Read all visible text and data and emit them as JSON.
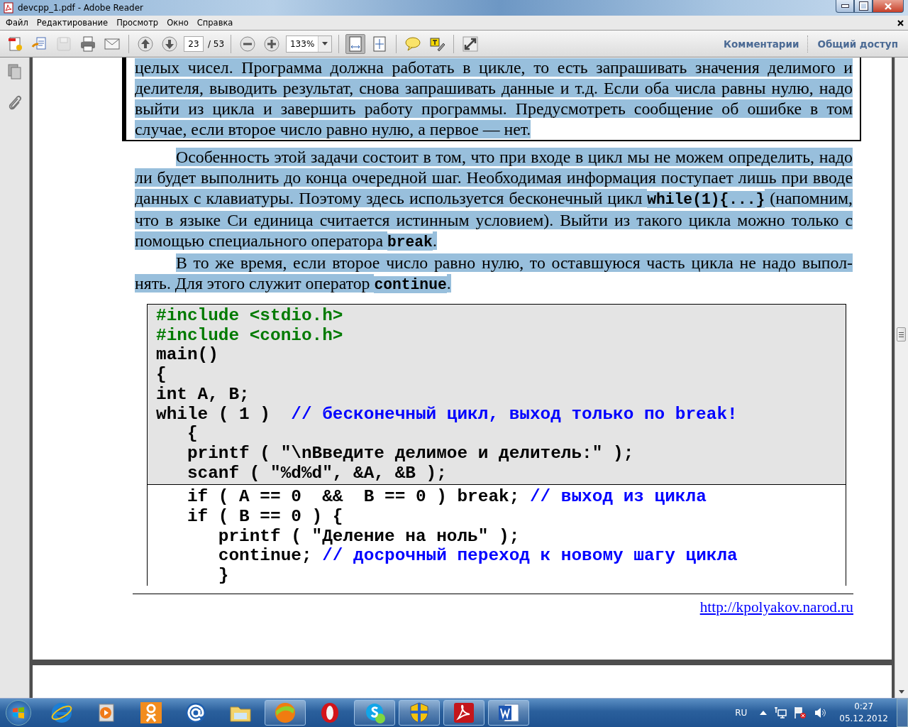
{
  "window": {
    "title": "devcpp_1.pdf - Adobe Reader"
  },
  "menu": [
    "Файл",
    "Редактирование",
    "Просмотр",
    "Окно",
    "Справка"
  ],
  "toolbar": {
    "buttons": [
      {
        "disabled": false,
        "selected": false
      },
      {
        "disabled": false,
        "selected": false
      },
      {
        "disabled": true,
        "selected": false
      },
      {
        "disabled": false,
        "selected": false
      },
      {
        "disabled": false,
        "selected": false
      },
      {
        "disabled": false,
        "selected": false
      },
      {
        "disabled": false,
        "selected": false
      },
      {
        "disabled": false,
        "selected": false
      },
      {
        "disabled": false,
        "selected": false
      },
      {
        "disabled": false,
        "selected": true
      },
      {
        "disabled": false,
        "selected": false
      },
      {
        "disabled": false,
        "selected": false
      },
      {
        "disabled": false,
        "selected": false
      },
      {
        "disabled": false,
        "selected": false
      }
    ],
    "page": "23",
    "page_total": "/ 53",
    "zoom": "133%",
    "links": [
      "Комментарии",
      "Общий доступ"
    ]
  },
  "document": {
    "boxed_paragraph": "целых чисел. Программа должна работать в цикле, то есть запрашивать значения делимого и делителя, выводить результат, снова запрашивать данные и т.д. Если оба числа равны нулю, надо выйти из цикла и завершить работу программы. Предусмотреть сообщение об ошибке в том случае, если второе число равно нулю, а первое — нет.",
    "paragraphs": [
      [
        {
          "kind": "text",
          "text": "Особенность этой задачи состоит в том, что при входе в цикл мы не можем определить, надо ли будет выполнить до конца очередной шаг. Необходимая информация поступает лишь при вводе данных с клавиатуры. Поэтому здесь используется бесконечный цикл "
        },
        {
          "kind": "code",
          "text": "while(1){...}"
        },
        {
          "kind": "text",
          "text": "  (напомним, что в языке Си единица считается истинным условием). Выйти из такого цикла можно только с помощью специального оператора "
        },
        {
          "kind": "code",
          "text": "break"
        },
        {
          "kind": "text",
          "text": "."
        }
      ],
      [
        {
          "kind": "text",
          "text": "В то же время, если второе число равно нулю, то оставшуюся часть цикла не надо выпол-нять. Для этого служит оператор "
        },
        {
          "kind": "code",
          "text": "continue"
        },
        {
          "kind": "text",
          "text": "."
        }
      ]
    ],
    "code_sections": [
      {
        "kind": "shaded",
        "lines": [
          [
            {
              "kind": "directive",
              "text": "#include <stdio.h>"
            }
          ],
          [
            {
              "kind": "directive",
              "text": "#include <conio.h>"
            }
          ],
          [
            {
              "kind": "code",
              "text": "main()"
            }
          ],
          [
            {
              "kind": "code",
              "text": "{"
            }
          ],
          [
            {
              "kind": "code",
              "text": "int A, B;"
            }
          ],
          [
            {
              "kind": "code",
              "text": "while ( 1 )  "
            },
            {
              "kind": "comment",
              "text": "// бесконечный цикл, выход только по break!"
            }
          ],
          [
            {
              "kind": "code",
              "text": "   {"
            }
          ],
          [
            {
              "kind": "code",
              "text": "   printf ( \"\\nВведите делимое и делитель:\" );"
            }
          ],
          [
            {
              "kind": "code",
              "text": "   scanf ( \"%d%d\", &A, &B );"
            }
          ]
        ]
      },
      {
        "kind": "plain",
        "lines": [
          [
            {
              "kind": "code",
              "text": "   if ( A == 0  &&  B == 0 ) break; "
            },
            {
              "kind": "comment",
              "text": "// выход из цикла"
            }
          ],
          [
            {
              "kind": "code",
              "text": "   if ( B == 0 ) {"
            }
          ],
          [
            {
              "kind": "code",
              "text": "      printf ( \"Деление на ноль\" );"
            }
          ],
          [
            {
              "kind": "code",
              "text": "      continue; "
            },
            {
              "kind": "comment",
              "text": "// досрочный переход к новому шагу цикла"
            }
          ],
          [
            {
              "kind": "code",
              "text": "      }"
            }
          ]
        ]
      }
    ],
    "footer_link": "http://kpolyakov.narod.ru"
  },
  "taskbar": {
    "buttons": [
      {
        "running": false
      },
      {
        "running": false
      },
      {
        "running": false
      },
      {
        "running": false
      },
      {
        "running": false
      },
      {
        "running": true
      },
      {
        "running": false
      },
      {
        "running": true
      },
      {
        "running": true
      },
      {
        "running": true
      },
      {
        "running": true
      }
    ],
    "language": "RU",
    "time": "0:27",
    "date": "05.12.2012"
  }
}
